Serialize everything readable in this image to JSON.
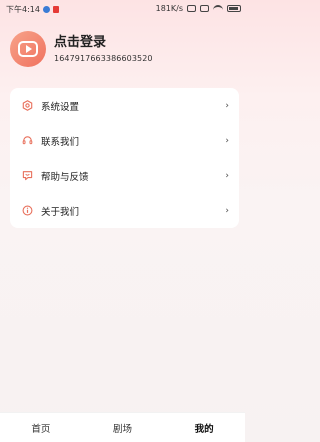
{
  "status_bar": {
    "time": "下午4:14",
    "network_speed": "181K/s"
  },
  "profile": {
    "login_title": "点击登录",
    "user_id": "1647917663386603520"
  },
  "menu": {
    "items": [
      {
        "label": "系统设置",
        "icon": "gear-icon"
      },
      {
        "label": "联系我们",
        "icon": "headset-icon"
      },
      {
        "label": "帮助与反馈",
        "icon": "feedback-icon"
      },
      {
        "label": "关于我们",
        "icon": "info-icon"
      }
    ],
    "arrow": "›"
  },
  "tabs": [
    {
      "label": "首页"
    },
    {
      "label": "剧场"
    },
    {
      "label": "我的"
    }
  ],
  "colors": {
    "accent": "#f0715e",
    "icon": "#e8705c"
  }
}
